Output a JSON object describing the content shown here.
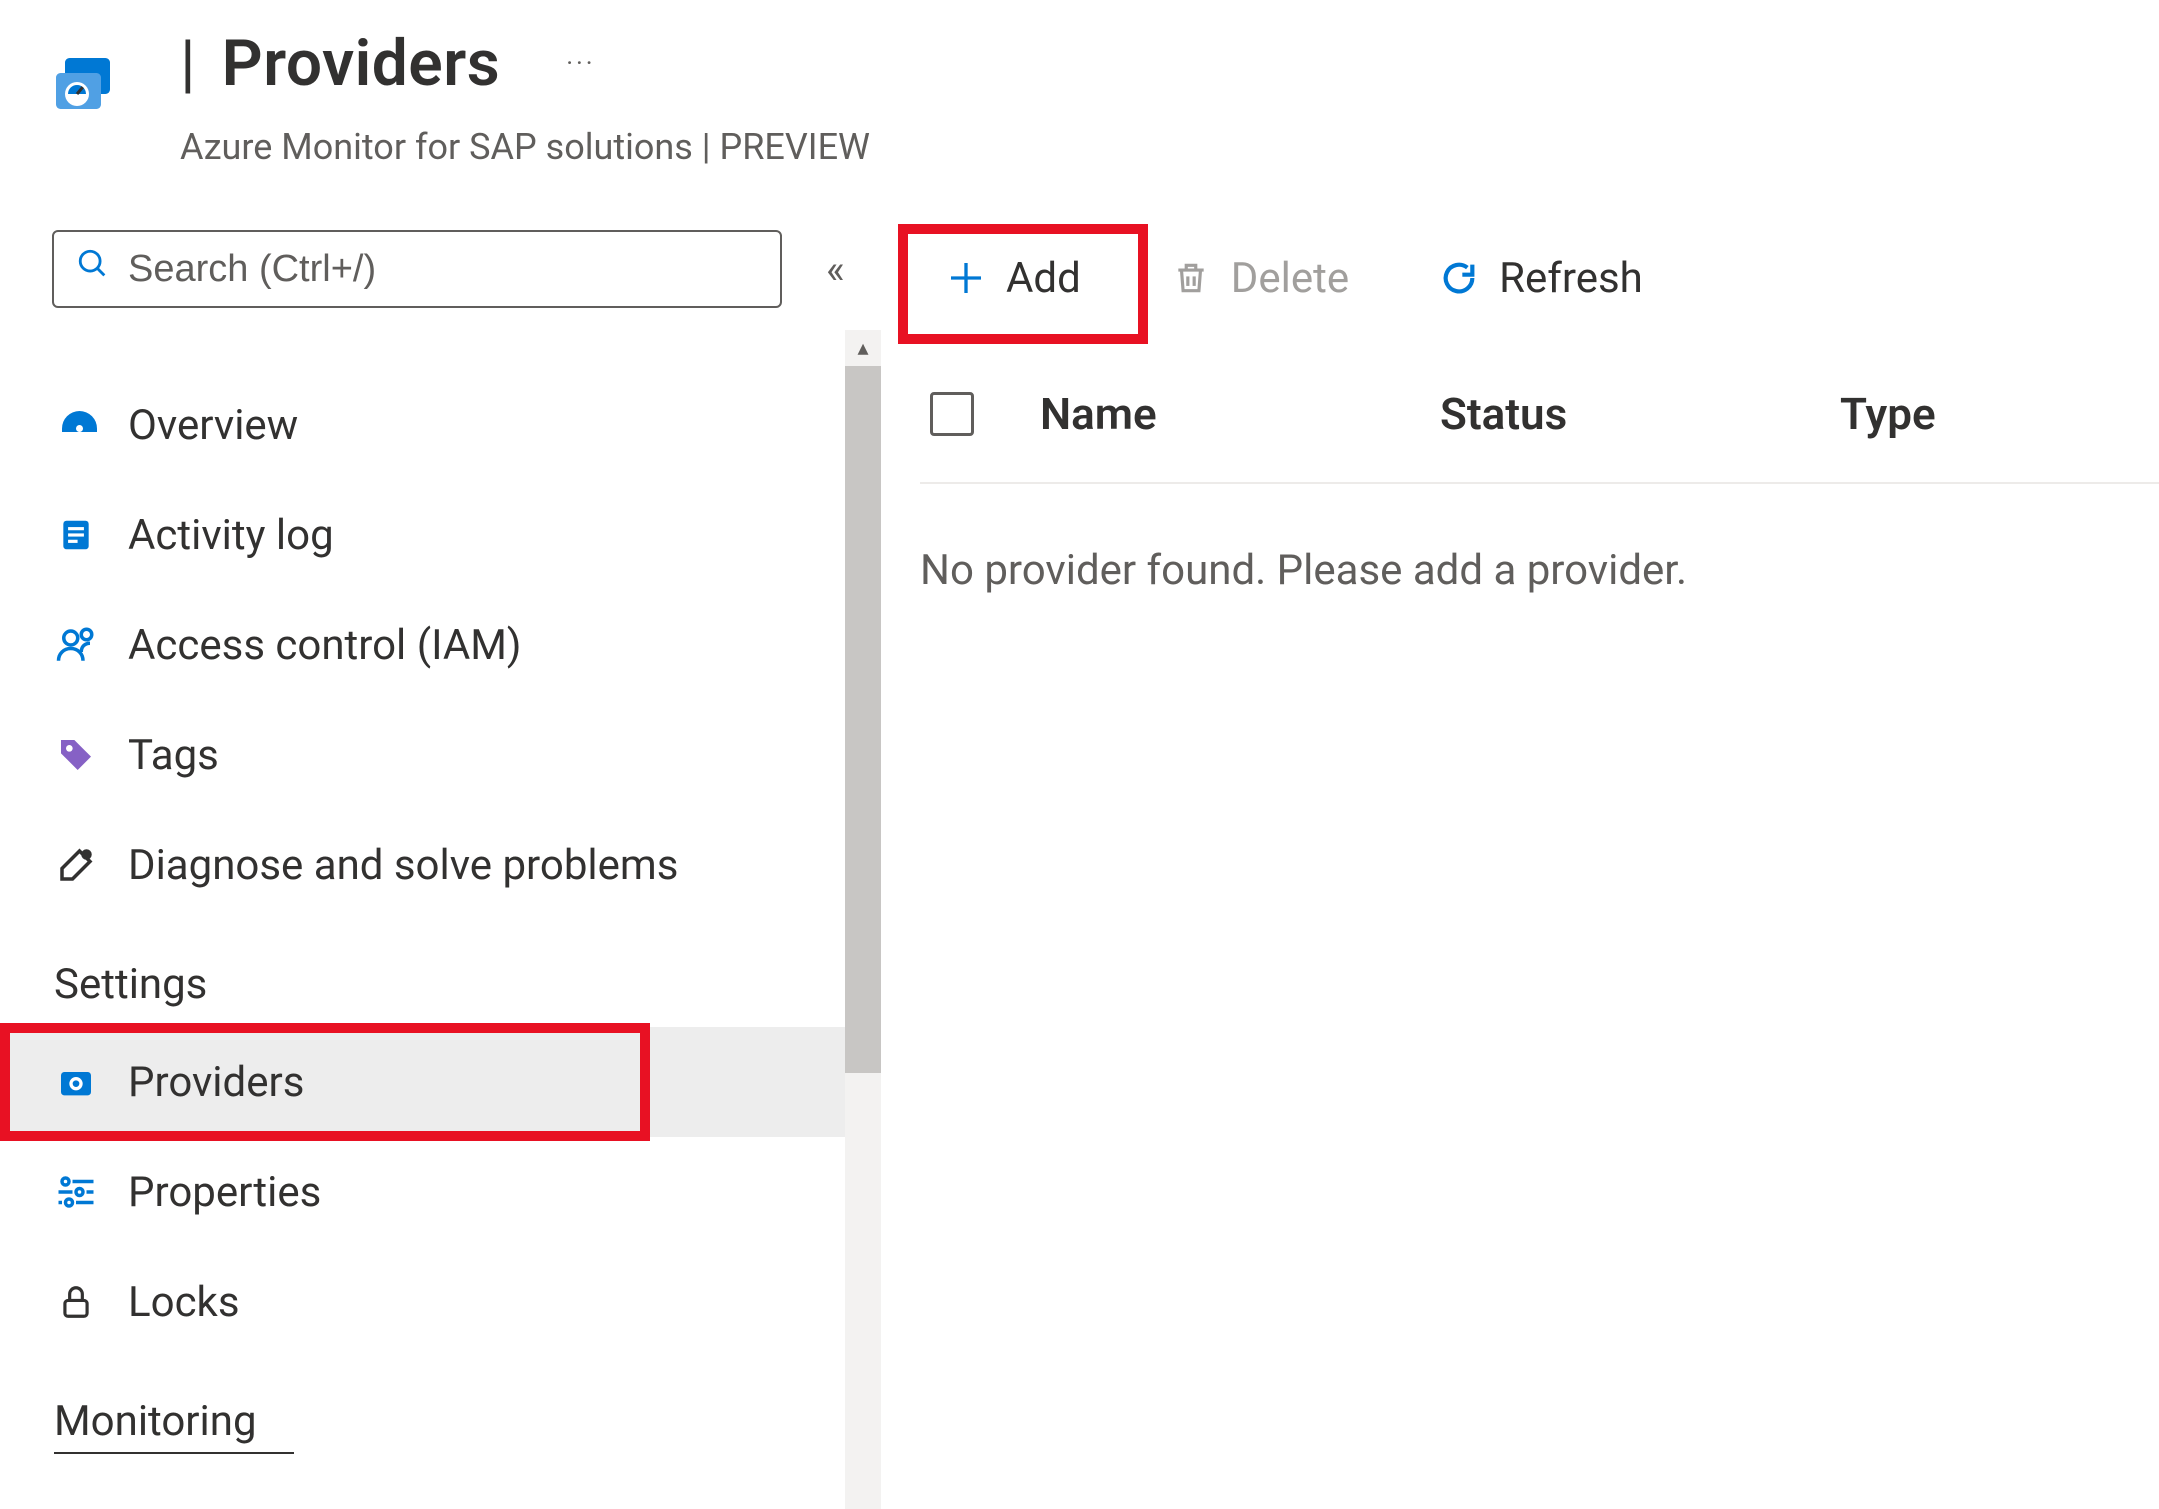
{
  "header": {
    "title": "Providers",
    "pipe": "|",
    "more": "···",
    "subtitle": "Azure Monitor for SAP solutions | PREVIEW"
  },
  "search": {
    "placeholder": "Search (Ctrl+/)"
  },
  "sidebar": {
    "items": [
      {
        "label": "Overview"
      },
      {
        "label": "Activity log"
      },
      {
        "label": "Access control (IAM)"
      },
      {
        "label": "Tags"
      },
      {
        "label": "Diagnose and solve problems"
      }
    ],
    "sections": {
      "settings": {
        "heading": "Settings",
        "items": [
          {
            "label": "Providers"
          },
          {
            "label": "Properties"
          },
          {
            "label": "Locks"
          }
        ]
      },
      "monitoring": {
        "heading": "Monitoring"
      }
    }
  },
  "toolbar": {
    "add": "Add",
    "delete": "Delete",
    "refresh": "Refresh"
  },
  "grid": {
    "cols": {
      "name": "Name",
      "status": "Status",
      "type": "Type"
    },
    "empty": "No provider found. Please add a provider."
  }
}
